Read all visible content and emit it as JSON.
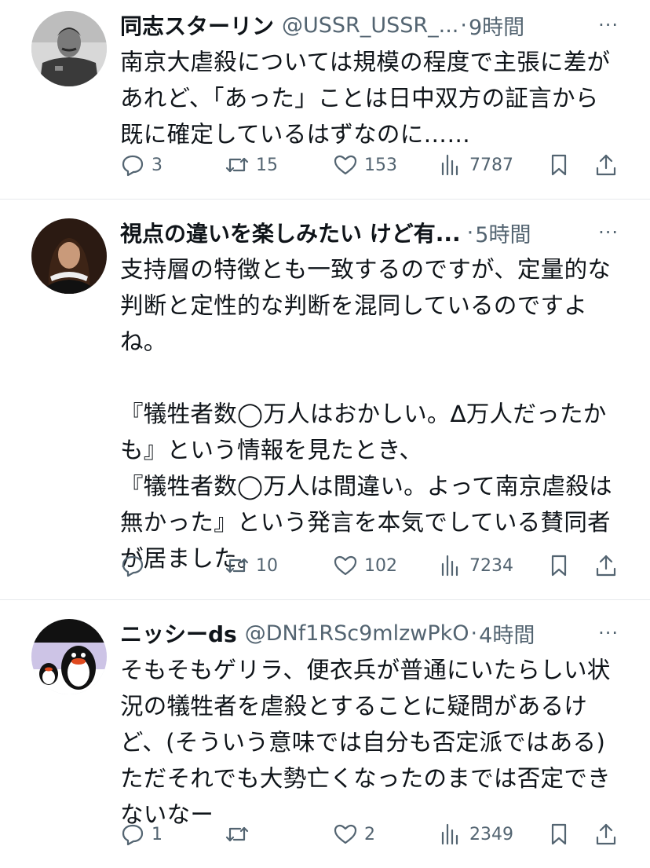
{
  "tweets": [
    {
      "display_name": "同志スターリン",
      "handle": "@USSR_USSR_...",
      "separator": "·",
      "time": "9時間",
      "more": "···",
      "text": "南京大虐殺については規模の程度で主張に差が\nあれど、「あった」ことは日中双方の証言から\n既に確定しているはずなのに……",
      "replies": "3",
      "retweets": "15",
      "likes": "153",
      "views": "7787"
    },
    {
      "display_name": "視点の違いを楽しみたい けど有...",
      "handle": "",
      "separator": "·",
      "time": "5時間",
      "more": "···",
      "text": "支持層の特徴とも一致するのですが、定量的な\n判断と定性的な判断を混同しているのですよ\nね。\n\n『犠牲者数◯万人はおかしい。∆万人だったか\nも』という情報を見たとき、\n『犠牲者数◯万人は間違い。よって南京虐殺は\n無かった』という発言を本気でしている賛同者\nが居ました。",
      "replies": "",
      "retweets": "10",
      "likes": "102",
      "views": "7234"
    },
    {
      "display_name": "ニッシーds",
      "handle": "@DNf1RSc9mlzwPkO",
      "separator": "·",
      "time": "4時間",
      "more": "···",
      "text": "そもそもゲリラ、便衣兵が普通にいたらしい状\n況の犠牲者を虐殺とすることに疑問があるけ\nど、(そういう意味では自分も否定派ではある)\nただそれでも大勢亡くなったのまでは否定でき\nないなー",
      "replies": "1",
      "retweets": "",
      "likes": "2",
      "views": "2349"
    }
  ],
  "icons": {
    "reply": "reply-icon",
    "retweet": "retweet-icon",
    "like": "heart-icon",
    "views": "views-icon",
    "bookmark": "bookmark-icon",
    "share": "share-icon"
  },
  "colors": {
    "text": "#0f1419",
    "secondary": "#536471",
    "divider": "#e6e9ec"
  }
}
